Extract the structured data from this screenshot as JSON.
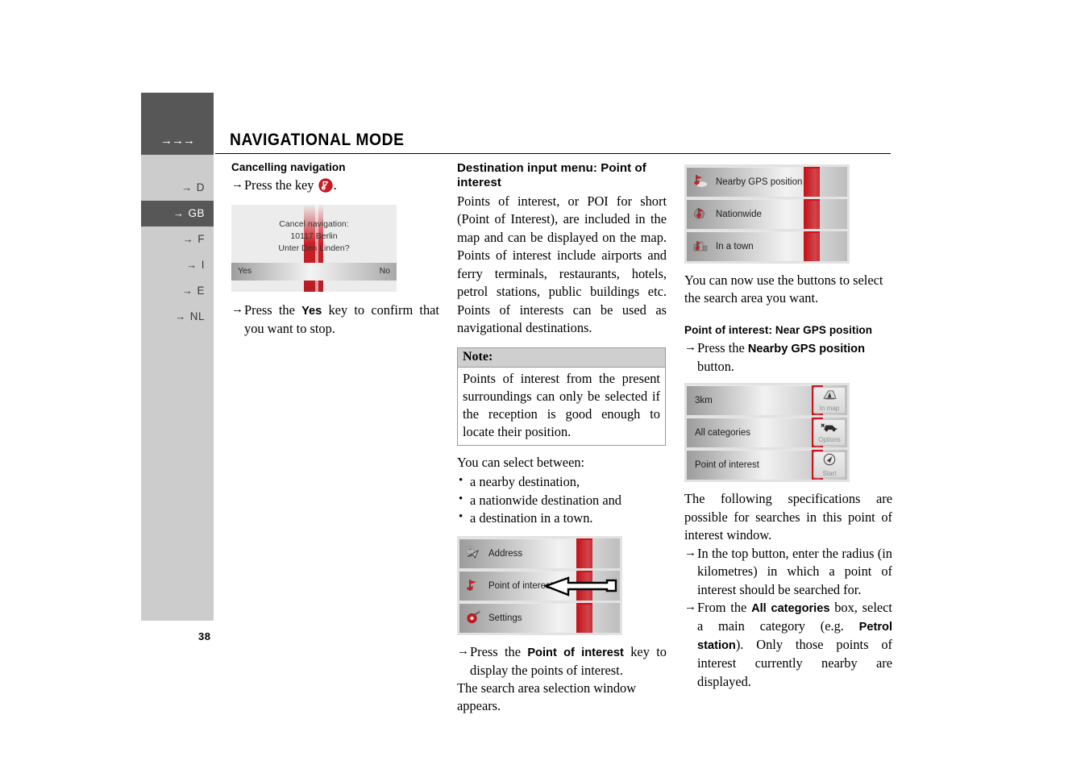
{
  "document": {
    "page_number": "38",
    "header_title": "NAVIGATIONAL MODE",
    "header_arrows": "→→→"
  },
  "sidebar": {
    "items": [
      {
        "label": "D",
        "arrow": "→",
        "active": false
      },
      {
        "label": "GB",
        "arrow": "→",
        "active": true
      },
      {
        "label": "F",
        "arrow": "→",
        "active": false
      },
      {
        "label": "I",
        "arrow": "→",
        "active": false
      },
      {
        "label": "E",
        "arrow": "→",
        "active": false
      },
      {
        "label": "NL",
        "arrow": "→",
        "active": false
      }
    ]
  },
  "column1": {
    "heading": "Cancelling navigation",
    "step1_pre": "Press the key",
    "step1_post": ".",
    "dialog": {
      "line1": "Cancel navigation:",
      "line2": "10117 Berlin",
      "line3": "Unter Den Linden?",
      "yes": "Yes",
      "no": "No"
    },
    "step2_pre": "Press the",
    "step2_key": "Yes",
    "step2_post": "key to confirm that you want to stop."
  },
  "column2": {
    "heading": "Destination input menu: Point of interest",
    "paragraph": "Points of interest, or POI for short (Point of Interest), are included in the map and can be displayed on the map. Points of interest include airports and ferry terminals, restaurants, hotels, petrol stations, public buildings etc. Points of interests can be used as navigational destinations.",
    "note": {
      "title": "Note:",
      "text": "Points of interest from the present surroundings can only be selected if the reception is good enough to locate their position."
    },
    "select_intro": "You can select between:",
    "bullets": [
      "a nearby destination,",
      "a nationwide destination and",
      "a destination in a town."
    ],
    "menu": {
      "rows": [
        {
          "label": "Address",
          "icon": "address-icon"
        },
        {
          "label": "Point of interest",
          "icon": "poi-flag-icon"
        },
        {
          "label": "Settings",
          "icon": "settings-icon"
        }
      ]
    },
    "step_pre": "Press the",
    "step_key": "Point of interest",
    "step_post": "key to display the points of interest.",
    "closing": "The search area selection window appears."
  },
  "column3": {
    "menu": {
      "rows": [
        {
          "label": "Nearby GPS position",
          "icon": "poi-gps-icon"
        },
        {
          "label": "Nationwide",
          "icon": "poi-nationwide-icon"
        },
        {
          "label": "In a town",
          "icon": "poi-town-icon"
        }
      ]
    },
    "paragraph1": "You can now use the buttons to select the search area you want.",
    "heading": "Point of interest: Near GPS position",
    "step1_pre": "Press the",
    "step1_key": "Nearby GPS position",
    "step1_post": "button.",
    "menu2": {
      "rows": [
        {
          "label": "3km",
          "side_label": "In map",
          "side_icon": "in-map-icon"
        },
        {
          "label": "All categories",
          "side_label": "Options",
          "side_icon": "options-car-icon"
        },
        {
          "label": "Point of interest",
          "side_label": "Start",
          "side_icon": "start-arrow-icon"
        }
      ]
    },
    "paragraph2": "The following specifications are possible for searches in this point of interest window.",
    "step2": "In the top button, enter the radius (in kilometres) in which a point of interest should be searched for.",
    "step3_pre": "From the",
    "step3_key1": "All categories",
    "step3_mid": "box, select a main category (e.g.",
    "step3_key2": "Petrol station",
    "step3_post": "). Only those points of interest currently nearby are displayed."
  },
  "colors": {
    "sidebar_bg": "#cccccc",
    "sidebar_active": "#575757",
    "accent_red": "#c31018",
    "note_header": "#cfcfcf"
  }
}
